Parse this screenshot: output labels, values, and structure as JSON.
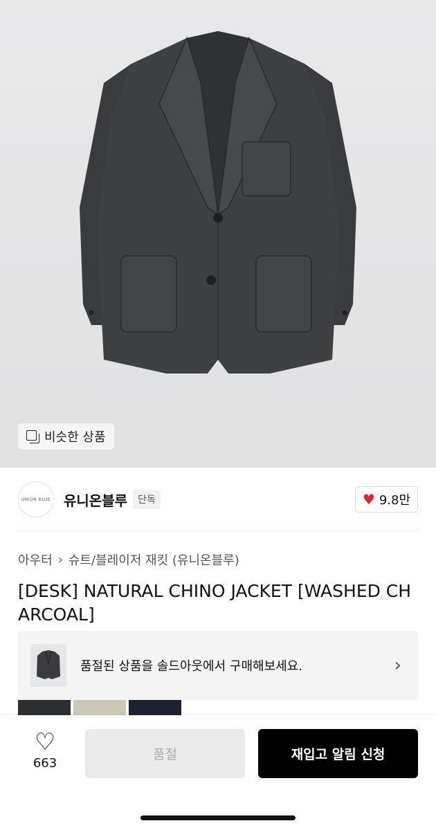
{
  "hero": {
    "similar_label": "비슷한 상품"
  },
  "brand": {
    "logo_text": "UNION BLUE",
    "name": "유니온블루",
    "badge": "단독",
    "likes": "9.8만"
  },
  "category": {
    "items": [
      "아우터",
      "슈트/블레이저 재킷 (유니온블루)"
    ]
  },
  "product": {
    "title": "[DESK] NATURAL CHINO JACKET [WASHED CHARCOAL]"
  },
  "soldout_banner": {
    "text": "품절된 상품을 솔드아웃에서 구매해보세요."
  },
  "swatches": {
    "colors": [
      "#2d2e30",
      "#cfc8b9",
      "#1d2230"
    ]
  },
  "bottom": {
    "wish_count": "663",
    "soldout_label": "품절",
    "restock_label": "재입고 알림 신청"
  },
  "colors": {
    "accent": "#e8232f",
    "primary_button": "#000000"
  }
}
